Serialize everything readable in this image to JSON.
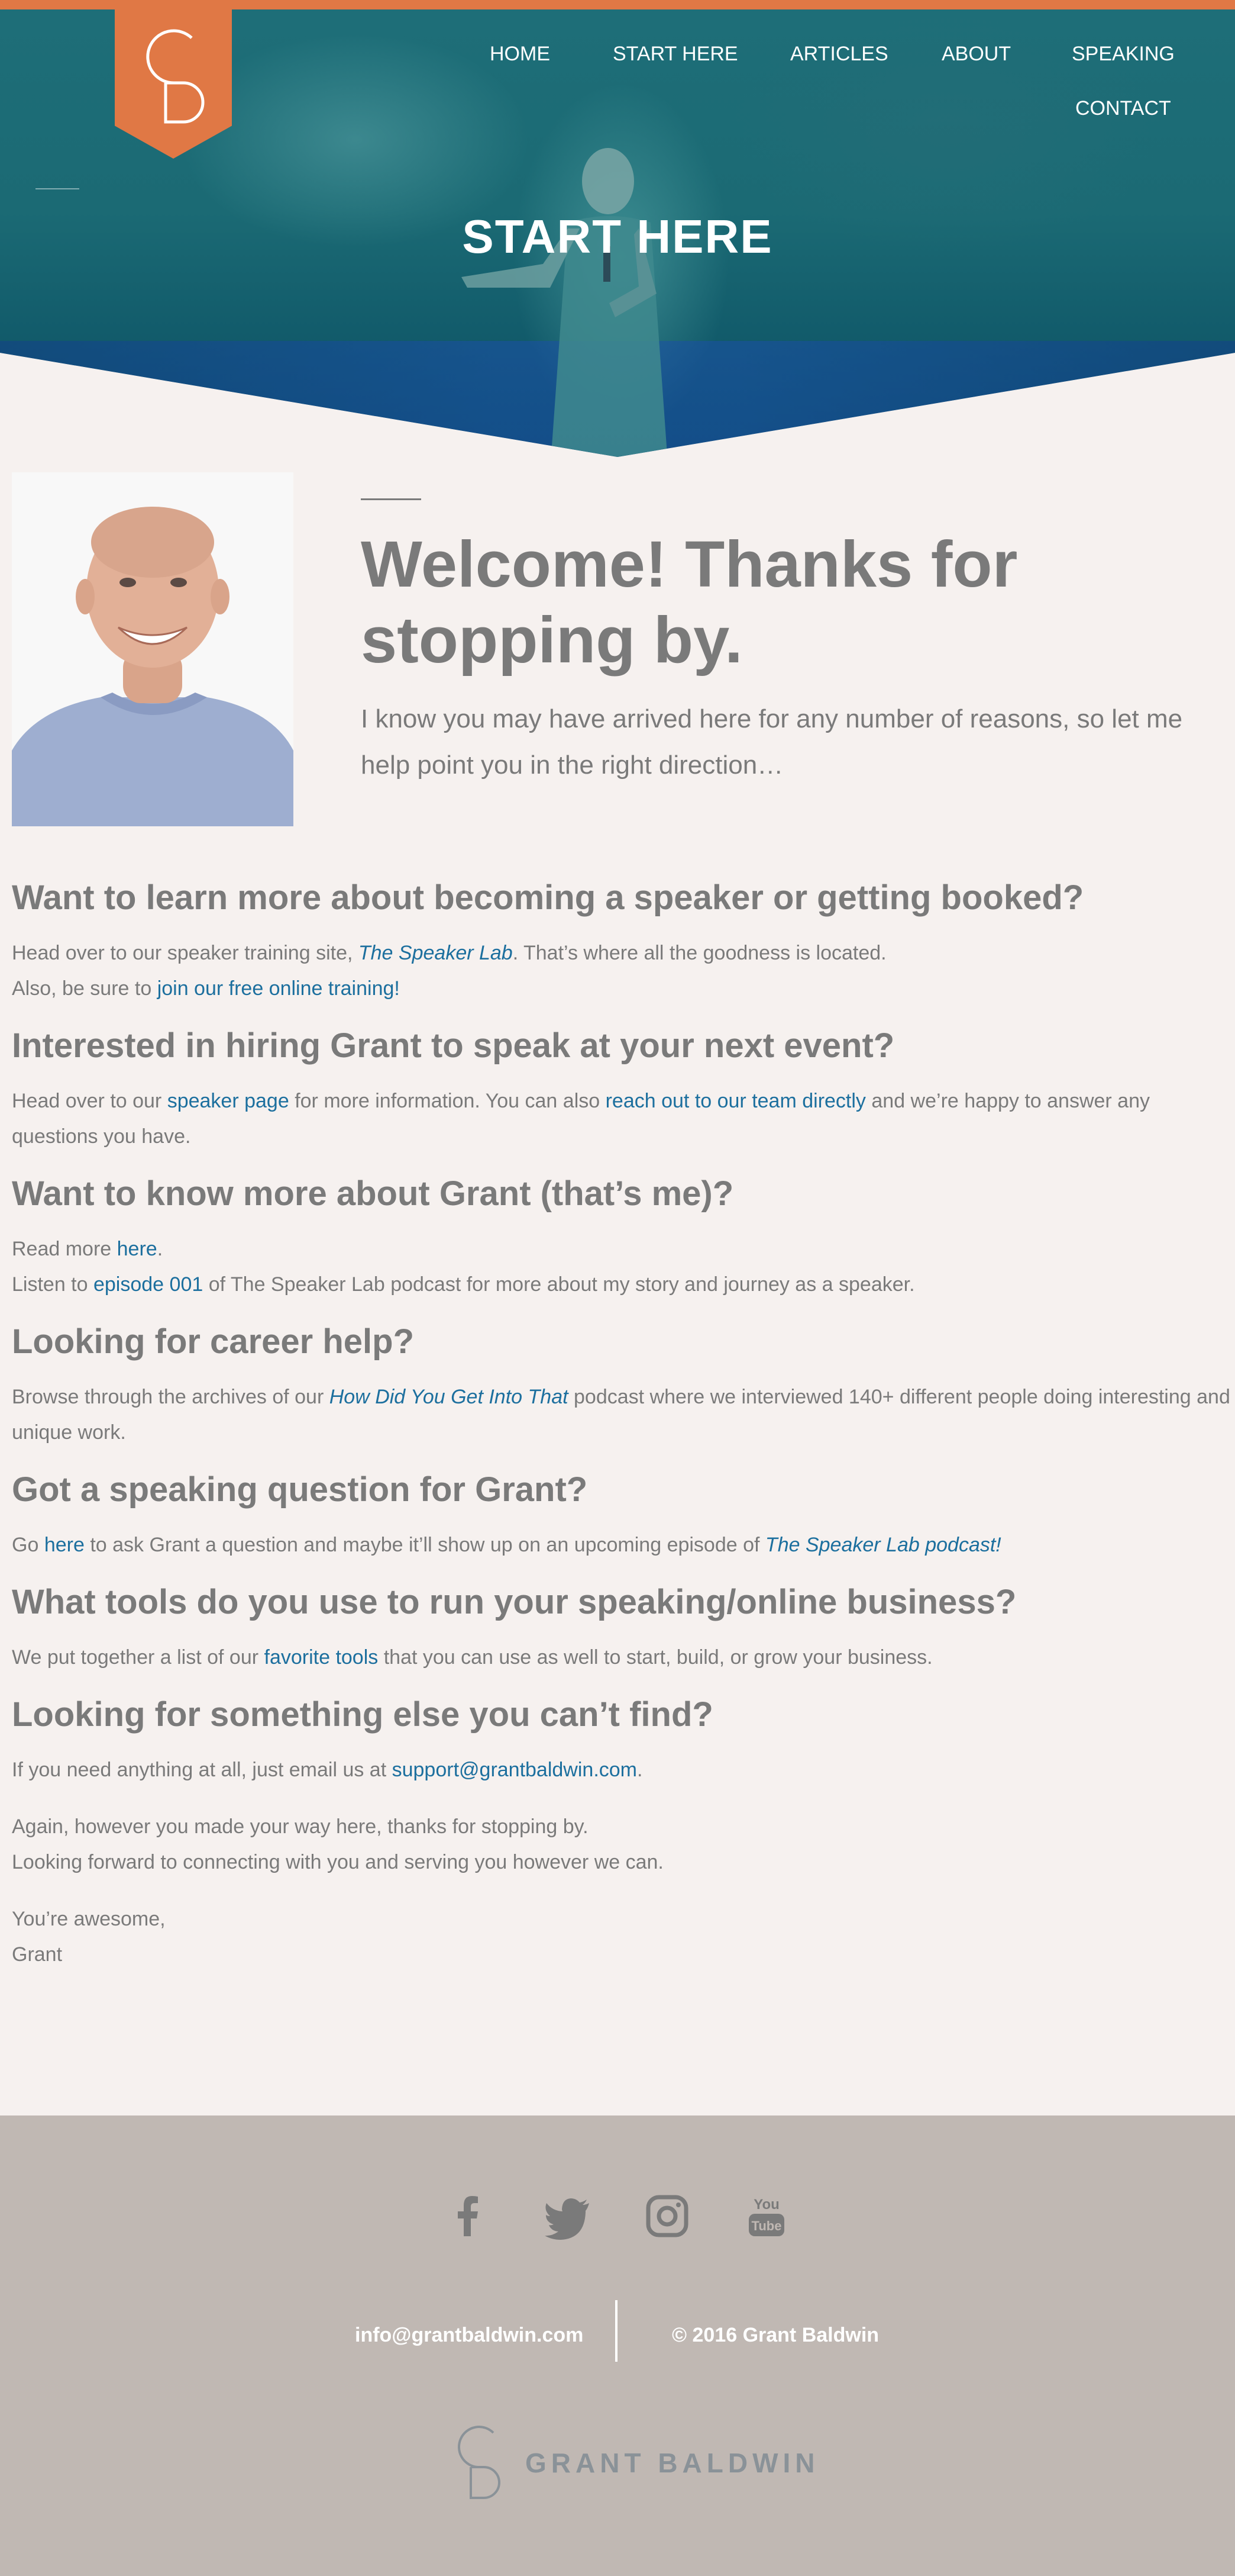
{
  "nav": {
    "home": "HOME",
    "start_here": "START HERE",
    "articles": "ARTICLES",
    "about": "ABOUT",
    "speaking": "SPEAKING",
    "contact": "CONTACT"
  },
  "hero": {
    "title": "START HERE"
  },
  "intro": {
    "title": "Welcome! Thanks for stopping by.",
    "subtitle": "I know you may have arrived here for any number of reasons, so let me help point you in the right direction…"
  },
  "sections": {
    "speaker": {
      "heading": "Want to learn more about becoming a speaker or getting booked?",
      "p1_pre": "Head over to our speaker training site, ",
      "p1_link": "The Speaker Lab",
      "p1_post": ". That’s where all the goodness is located.",
      "p2_pre": "Also, be sure to ",
      "p2_link": "join our free online training!"
    },
    "hire": {
      "heading": "Interested in hiring Grant to speak at your next event?",
      "p_pre": "Head over to our ",
      "p_link1": "speaker page",
      "p_mid": " for more information. You can also ",
      "p_link2": "reach out to our team directly",
      "p_post": " and we’re happy to answer any questions you have."
    },
    "about": {
      "heading": "Want to know more about Grant (that’s me)?",
      "p1_pre": "Read more ",
      "p1_link": "here",
      "p1_post": ".",
      "p2_pre": "Listen to ",
      "p2_link": "episode 001",
      "p2_post": " of The Speaker Lab podcast for more about my story and journey as a speaker."
    },
    "career": {
      "heading": "Looking for career help?",
      "p_pre": "Browse through the archives of our ",
      "p_link": "How Did You Get Into That",
      "p_post": " podcast where we interviewed 140+ different people doing interesting and unique work."
    },
    "question": {
      "heading": "Got a speaking question for Grant?",
      "p_pre": "Go ",
      "p_link1": "here",
      "p_mid": " to ask Grant a question and maybe it’ll show up on an upcoming episode of ",
      "p_link2": "The Speaker Lab podcast!"
    },
    "tools": {
      "heading": "What tools do you use to run your speaking/online business?",
      "p_pre": "We put together a list of our ",
      "p_link": "favorite tools",
      "p_post": " that you can use as well to start, build, or grow your business."
    },
    "else": {
      "heading": "Looking for something else you can’t find?",
      "p_pre": "If you need anything at all, just email us at ",
      "p_link": "support@grantbaldwin.com",
      "p_post": "."
    },
    "closing": {
      "line1": "Again, however you made your way here, thanks for stopping by.",
      "line2": "Looking forward to connecting with you and serving you however we can.",
      "line3": "You’re awesome,",
      "line4": "Grant"
    }
  },
  "footer": {
    "email": "info@grantbaldwin.com",
    "copyright": "© 2016 Grant Baldwin",
    "logo_text": "GRANT BALDWIN",
    "social": [
      "facebook-icon",
      "twitter-icon",
      "instagram-icon",
      "youtube-icon"
    ]
  },
  "colors": {
    "accent": "#e07845",
    "link": "#1c6f9e",
    "text": "#7a7a7a",
    "background": "#f6f1ef",
    "footer": "#c0b8b3"
  }
}
